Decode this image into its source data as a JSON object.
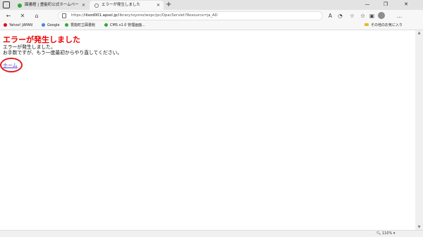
{
  "browser": {
    "tabs": [
      {
        "title": "図書館 | 豊能町公式ホームページ",
        "close": "✕"
      },
      {
        "title": "エラーが発生しました",
        "close": "✕"
      }
    ],
    "new_tab": "+",
    "window": {
      "minimize": "—",
      "maximize": "❐",
      "close": "✕"
    }
  },
  "address_bar": {
    "url_prefix": "https://",
    "url_host": "ilisod001.apsel.jp",
    "url_path": "/library.toyono/wopc/pc/OpacServlet?Resource=ja_AD"
  },
  "favorites": [
    {
      "label": "Yahoo! JAPAN",
      "icon": "yahoo-icon"
    },
    {
      "label": "Google",
      "icon": "google-icon"
    },
    {
      "label": "豊能町立図書館",
      "icon": "site-icon"
    },
    {
      "label": "CMS v1.0 管理画面...",
      "icon": "site-icon"
    }
  ],
  "other_favorites": "その他のお気に入り",
  "page": {
    "title": "エラーが発生しました",
    "line1": "エラーが発生しました。",
    "line2": "お手数ですが、もう一度最初からやり直してください。",
    "home_link": "ホーム"
  },
  "status": {
    "zoom": "110%"
  },
  "colors": {
    "error_title": "#ee0000",
    "link": "#5a3fd3",
    "annotation_circle": "#e02020"
  }
}
